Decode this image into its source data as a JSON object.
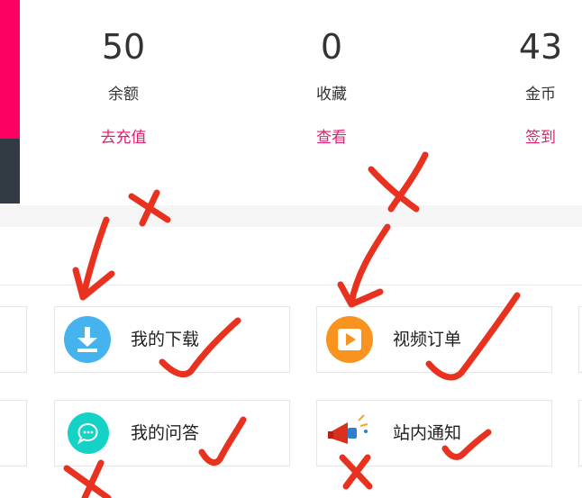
{
  "stats": [
    {
      "value": "50",
      "label": "余额",
      "action": "去充值"
    },
    {
      "value": "0",
      "label": "收藏",
      "action": "查看"
    },
    {
      "value": "43",
      "label": "金币",
      "action": "签到"
    }
  ],
  "menu": [
    {
      "label": "我的下载",
      "icon": "download-icon"
    },
    {
      "label": "视频订单",
      "icon": "video-play-icon"
    },
    {
      "label": "我的问答",
      "icon": "chat-bubble-icon"
    },
    {
      "label": "站内通知",
      "icon": "megaphone-icon"
    }
  ],
  "colors": {
    "accent_pink": "#fe0061",
    "action_text": "#e0206f",
    "annotation_red": "#e8321f"
  }
}
